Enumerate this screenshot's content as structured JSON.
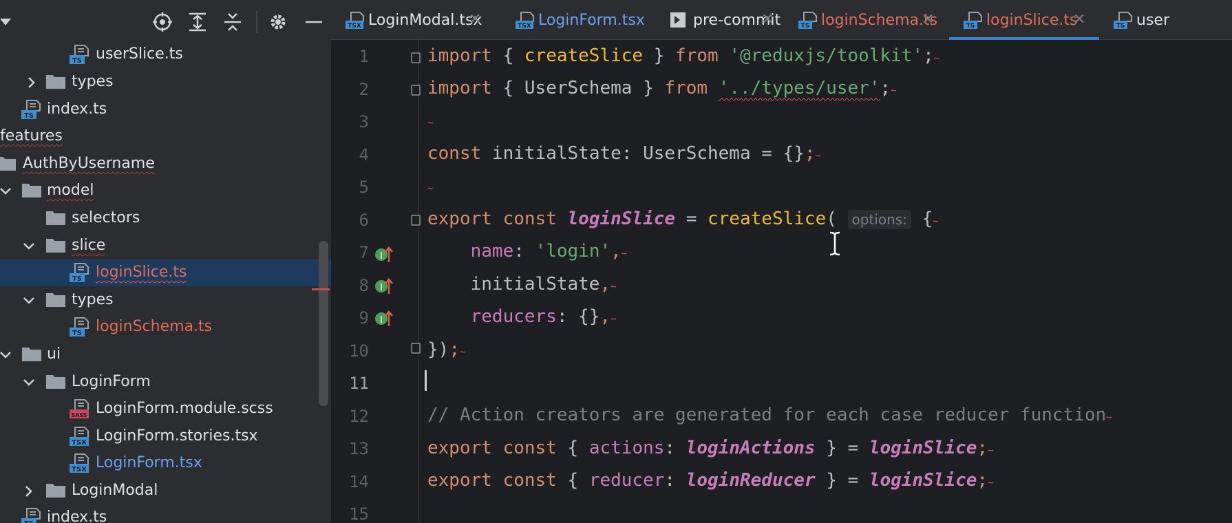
{
  "project_tree": {
    "rows": [
      {
        "label": "userSlice.ts",
        "kind": "ts"
      },
      {
        "label": "types",
        "kind": "folder"
      },
      {
        "label": "index.ts",
        "kind": "ts"
      },
      {
        "label": "features",
        "kind": "folder"
      },
      {
        "label": "AuthByUsername",
        "kind": "folder"
      },
      {
        "label": "model",
        "kind": "folder"
      },
      {
        "label": "selectors",
        "kind": "folder"
      },
      {
        "label": "slice",
        "kind": "folder"
      },
      {
        "label": "loginSlice.ts",
        "kind": "ts"
      },
      {
        "label": "types",
        "kind": "folder"
      },
      {
        "label": "loginSchema.ts",
        "kind": "ts"
      },
      {
        "label": "ui",
        "kind": "folder"
      },
      {
        "label": "LoginForm",
        "kind": "folder"
      },
      {
        "label": "LoginForm.module.scss",
        "kind": "scss"
      },
      {
        "label": "LoginForm.stories.tsx",
        "kind": "tsx"
      },
      {
        "label": "LoginForm.tsx",
        "kind": "tsx"
      },
      {
        "label": "LoginModal",
        "kind": "folder"
      },
      {
        "label": "index.ts",
        "kind": "ts"
      }
    ],
    "file_icon_text": {
      "ts": "TS",
      "tsx": "TSX",
      "scss": "SASS"
    }
  },
  "toolbar_icons": [
    "locate-icon",
    "expand-all-icon",
    "collapse-all-icon",
    "gear-icon",
    "minimize-icon"
  ],
  "tabs": [
    {
      "label": "LoginModal.tsx",
      "icon_text": "TSX"
    },
    {
      "label": "LoginForm.tsx",
      "icon_text": "TSX"
    },
    {
      "label": "pre-commit",
      "icon_text": ""
    },
    {
      "label": "loginSchema.ts",
      "icon_text": "TS"
    },
    {
      "label": "loginSlice.ts",
      "icon_text": "TS"
    },
    {
      "label": "user",
      "icon_text": "TS"
    }
  ],
  "code": {
    "line_numbers": [
      "1",
      "2",
      "3",
      "4",
      "5",
      "6",
      "7",
      "8",
      "9",
      "10",
      "11",
      "12",
      "13",
      "14",
      "15"
    ],
    "l1": {
      "kw1": "import",
      "p1": " { ",
      "id": "createSlice",
      "p2": " } ",
      "kw2": "from",
      "sp": " ",
      "str": "'@reduxjs/toolkit'",
      "end": ";"
    },
    "l2": {
      "kw1": "import",
      "p1": " { ",
      "id": "UserSchema",
      "p2": " } ",
      "kw2": "from",
      "sp": " ",
      "str": "'../types/user'",
      "end": ";"
    },
    "l4": {
      "kw": "const",
      "rest": " initialState: UserSchema = {}",
      "end": ";"
    },
    "l6": {
      "kw1": "export",
      "sp": " ",
      "kw2": "const",
      "sp2": " ",
      "name": "loginSlice",
      "eq": " = ",
      "fn": "createSlice",
      "paren": "(",
      "hint": "options:",
      "brace": " {"
    },
    "l7": {
      "prop": "name",
      "colon": ": ",
      "str": "'login'",
      "end": ","
    },
    "l8": {
      "text": "initialState",
      "end": ","
    },
    "l9": {
      "prop": "reducers",
      "rest": ": {}",
      "end": ","
    },
    "l10": {
      "text": "})",
      "end": ";"
    },
    "l12": {
      "comment": "// Action creators are generated for each case reducer function"
    },
    "l13": {
      "kw1": "export",
      "kw2": "const",
      "p1": " { ",
      "prop": "actions",
      "colon": ": ",
      "alias": "loginActions",
      "p2": " } = ",
      "src": "loginSlice",
      "end": ";"
    },
    "l14": {
      "kw1": "export",
      "kw2": "const",
      "p1": " { ",
      "prop": "reducer",
      "colon": ": ",
      "alias": "loginReducer",
      "p2": " } = ",
      "src": "loginSlice",
      "end": ";"
    }
  },
  "colors": {
    "keyword": "#cf8e6d",
    "string": "#6aab73",
    "property": "#c77dbb",
    "error_red": "#e06c5a",
    "modified_blue": "#6aa0ee",
    "selection": "#1e3a5c",
    "active_tab_underline": "#3d7fd1"
  }
}
